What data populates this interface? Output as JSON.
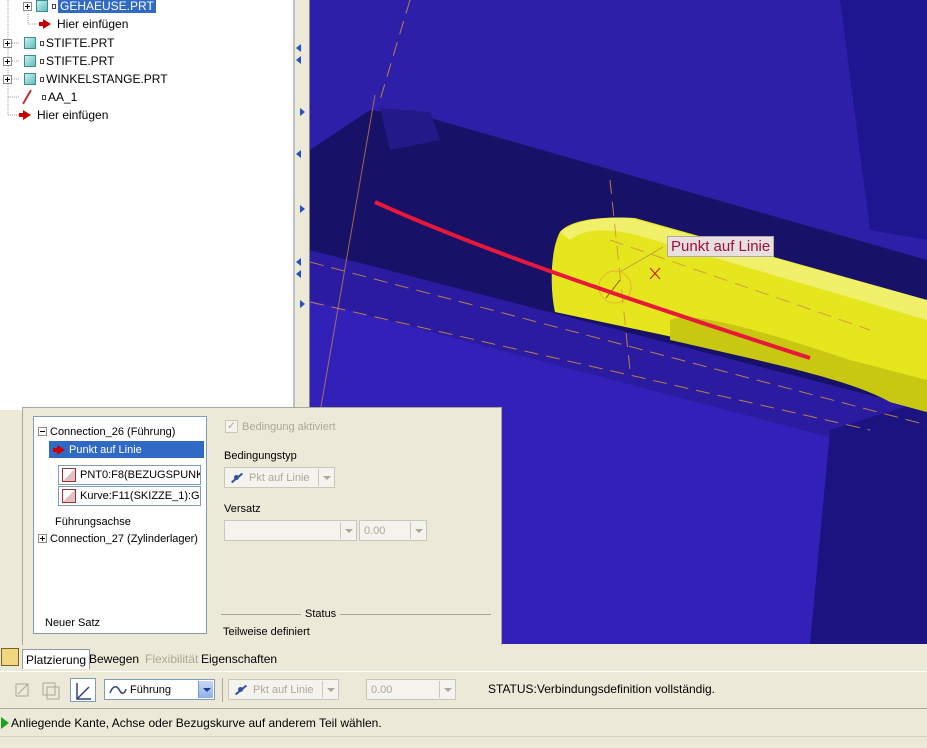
{
  "model_tree": {
    "items": [
      {
        "label": "GEHAEUSE.PRT",
        "selected": true
      },
      {
        "label": "Hier einfügen"
      },
      {
        "label": "STIFTE.PRT"
      },
      {
        "label": "STIFTE.PRT"
      },
      {
        "label": "WINKELSTANGE.PRT"
      },
      {
        "label": "AA_1"
      },
      {
        "label": "Hier einfügen"
      }
    ]
  },
  "viewport": {
    "constraint_label": "Punkt auf Linie",
    "colors": {
      "background": "#2e1fa8",
      "part": "#e6e61e",
      "curve": "#e8183a"
    }
  },
  "placement_panel": {
    "tree": {
      "connection_1": "Connection_26 (Führung)",
      "selected_constraint": "Punkt auf Linie",
      "ref_1": "PNT0:F8(BEZUGSPUNK",
      "ref_2": "Kurve:F11(SKIZZE_1):G",
      "axis_label": "Führungsachse",
      "connection_2": "Connection_27 (Zylinderlager)",
      "new_set": "Neuer Satz"
    },
    "enabled_label": "Bedingung aktiviert",
    "type_label": "Bedingungstyp",
    "type_value": "Pkt auf Linie",
    "offset_label": "Versatz",
    "offset_value": "",
    "offset_num": "0.00",
    "status_title": "Status",
    "status_value": "Teilweise definiert"
  },
  "tabs": [
    "Platzierung",
    "Bewegen",
    "Flexibilität",
    "Eigenschaften"
  ],
  "dashboard": {
    "connection_type": "Führung",
    "constraint_type": "Pkt auf Linie",
    "offset": "0.00",
    "status": "STATUS:Verbindungsdefinition vollständig."
  },
  "message": "Anliegende Kante, Achse oder Bezugskurve auf anderem Teil wählen."
}
